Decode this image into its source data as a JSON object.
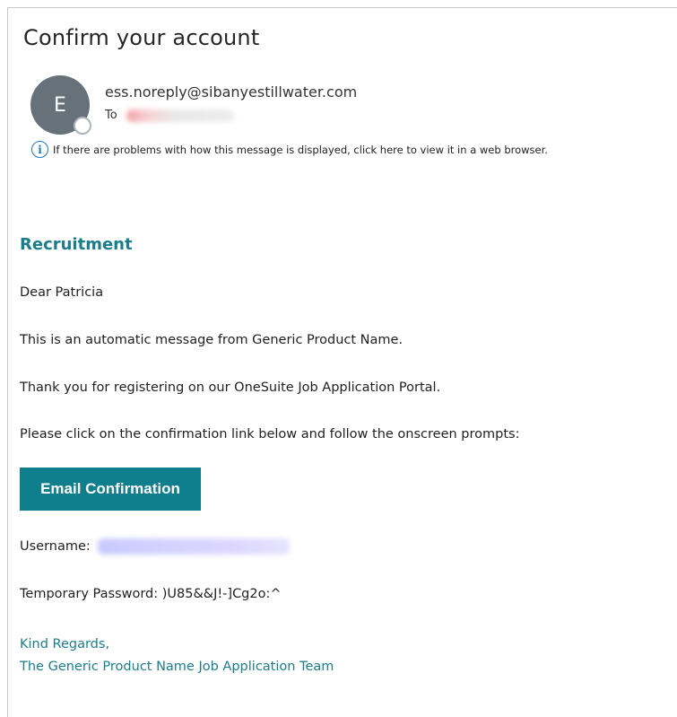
{
  "email": {
    "subject": "Confirm your account",
    "avatar_initial": "E",
    "sender": "ess.noreply@sibanyestillwater.com",
    "to_label": "To",
    "info_icon": "info-icon",
    "info_notice": "If there are problems with how this message is displayed, click here to view it in a web browser."
  },
  "body": {
    "section_title": "Recruitment",
    "greeting": "Dear Patricia",
    "line1": "This is an automatic message from Generic Product Name.",
    "line2": "Thank you for registering on our OneSuite Job Application Portal.",
    "line3": "Please click on the confirmation link below and follow the onscreen prompts:",
    "confirm_button": "Email Confirmation",
    "username_label": "Username:",
    "password_label": "Temporary Password:",
    "password_value": ")U85&&J!-]Cg2o:^",
    "regards_line1": "Kind Regards,",
    "regards_line2": "The Generic Product Name Job Application Team"
  },
  "colors": {
    "accent": "#1a7d8c",
    "button": "#0f7f8e",
    "avatar": "#66717a",
    "info": "#1b76c4"
  }
}
